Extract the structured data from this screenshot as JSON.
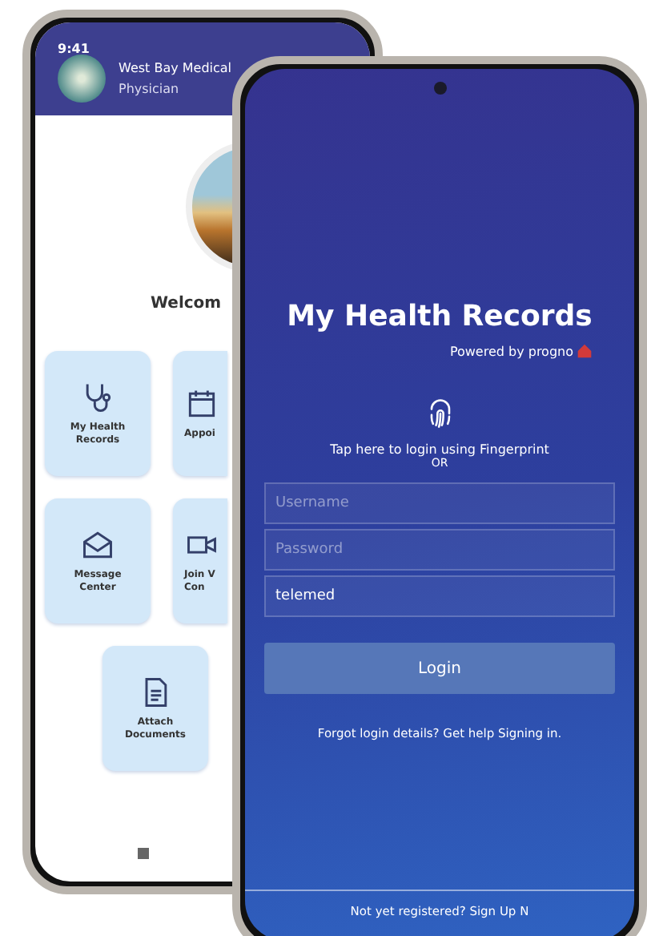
{
  "back_phone": {
    "status_time": "9:41",
    "header": {
      "title": "West Bay Medical",
      "subtitle": "Physician"
    },
    "welcome": "Welcom",
    "tiles": [
      {
        "kind": "stethoscope",
        "lines": [
          "My Health",
          "Records"
        ]
      },
      {
        "kind": "calendar",
        "lines": [
          "Appoi"
        ]
      },
      {
        "kind": "mail",
        "lines": [
          "Message",
          "Center"
        ]
      },
      {
        "kind": "video",
        "lines": [
          "Join V",
          "Con"
        ]
      },
      {
        "kind": "document",
        "lines": [
          "Attach",
          "Documents"
        ]
      }
    ]
  },
  "front_phone": {
    "title": "My Health Records",
    "powered_by": "Powered by progno",
    "fingerprint_prompt": "Tap here to login using Fingerprint",
    "or_text": "OR",
    "fields": [
      {
        "placeholder": "Username"
      },
      {
        "placeholder": "Password"
      },
      {
        "value": "telemed"
      }
    ],
    "login_button": "Login",
    "help_text": "Forgot login details? Get help Signing in.",
    "signup_text": "Not yet registered? Sign Up N"
  }
}
